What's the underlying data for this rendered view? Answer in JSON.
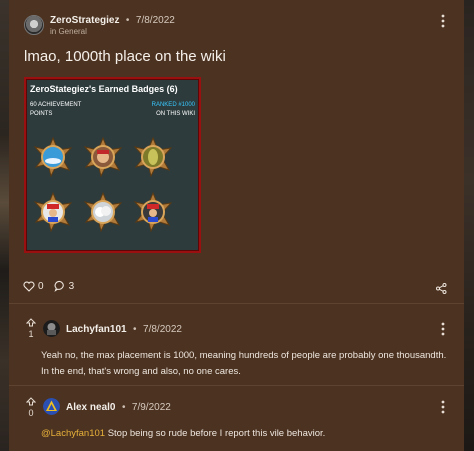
{
  "post": {
    "author": "ZeroStrategiez",
    "separator": "•",
    "date": "7/8/2022",
    "category": "in General",
    "title": "lmao, 1000th place on the wiki",
    "likes": "0",
    "comments": "3"
  },
  "badge_card": {
    "title": "ZeroStategiez's Earned Badges (6)",
    "points_line1": "60 ACHIEVEMENT",
    "points_line2": "POINTS",
    "rank_line1": "RANKED #1000",
    "rank_line2": "ON THIS WIKI",
    "accent_color": "#38c8ff",
    "border_color": "#9a1010",
    "badges": [
      "sky-badge",
      "mario-badge",
      "leaf-badge",
      "mario-badge",
      "cloud-badge",
      "mario-badge"
    ]
  },
  "replies": [
    {
      "votes": "1",
      "author": "Lachyfan101",
      "separator": "•",
      "date": "7/8/2022",
      "text": "Yeah no, the max placement is 1000, meaning hundreds of people are probably one thousandth. In the end, that's wrong and also, no one cares."
    },
    {
      "votes": "0",
      "author": "Alex neal0",
      "separator": "•",
      "date": "7/9/2022",
      "mention": "@Lachyfan101",
      "text": " Stop being so rude before I report this vile behavior."
    }
  ],
  "icons": {
    "like": "heart-icon",
    "comment": "comment-icon",
    "share": "share-icon",
    "menu": "kebab-menu-icon",
    "upvote": "upvote-arrow-icon"
  },
  "colors": {
    "panel": "#4b3221",
    "background": "#2a221c",
    "mention": "#e8b23a"
  }
}
